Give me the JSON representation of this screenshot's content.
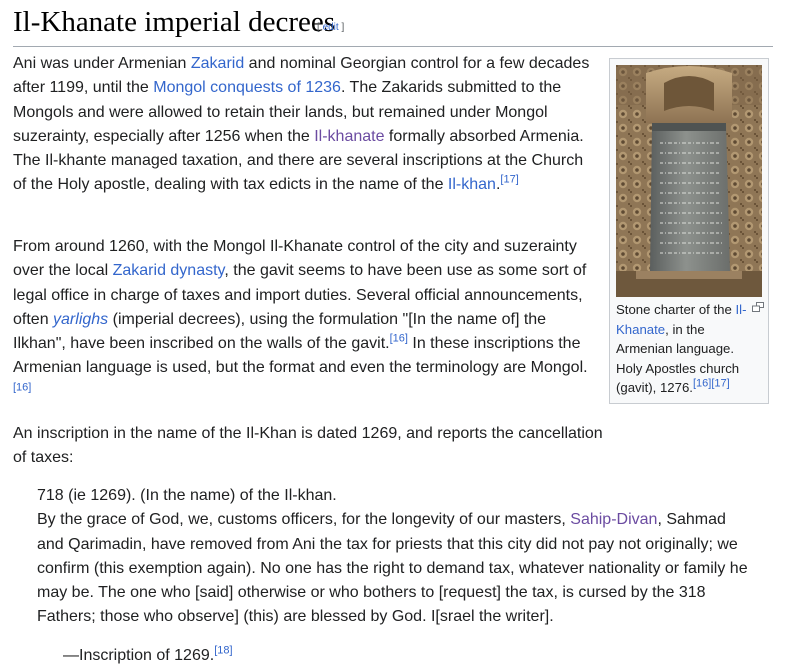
{
  "section": {
    "title": "Il-Khanate imperial decrees",
    "edit_open": "[ ",
    "edit_label": "edit",
    "edit_close": " ]"
  },
  "p1": {
    "t1": "Ani was under Armenian ",
    "l1": "Zakarid",
    "t2": " and nominal Georgian control for a few decades after 1199, until the ",
    "l2": "Mongol conquests of 1236",
    "t3": ". The Zakarids submitted to the Mongols and were allowed to retain their lands, but remained under Mongol suzerainty, especially after 1256 when the ",
    "l3": "Il-khanate",
    "t4": " formally absorbed Armenia. The Il-khante managed taxation, and there are several inscriptions at the Church of the Holy apostle, dealing with tax edicts in the name of the ",
    "l4": "Il-khan",
    "t5": ".",
    "ref1": "[17]"
  },
  "p2": {
    "t1": "From around 1260, with the Mongol Il-Khanate control of the city and suzerainty over the local ",
    "l1": "Zakarid dynasty",
    "t2": ", the gavit seems to have been use as some sort of legal office in charge of taxes and import duties. Several official announcements, often ",
    "l2": "yarlighs",
    "t3": " (imperial decrees), using the formulation \"[In the name of] the Ilkhan\", have been inscribed on the walls of the gavit.",
    "ref1": "[16]",
    "t4": " In these inscriptions the Armenian language is used, but the format and even the terminology are Mongol.",
    "ref2": "[16]"
  },
  "p3": {
    "text": "An inscription in the name of the Il-Khan is dated 1269, and reports the cancellation of taxes:"
  },
  "quote": {
    "line1": "718 (ie 1269). (In the name) of the Il-khan.",
    "t1": "By the grace of God, we, customs officers, for the longevity of our masters, ",
    "l1": "Sahip-Divan",
    "t2": ", Sahmad and Qarimadin, have removed from Ani the tax for priests that this city did not pay not originally; we confirm (this exemption again). No one has the right to demand tax, whatever nationality or family he may be. The one who [said] otherwise or who bothers to [request] the tax, is cursed by the 318 Fathers; those who observe] (this) are blessed by God. I[srael the writer]."
  },
  "attribution": {
    "dash": "—",
    "text": "Inscription of 1269.",
    "ref": "[18]"
  },
  "figure": {
    "caption_t1": "Stone charter of the ",
    "caption_link": "Il-Khanate",
    "caption_t2": ", in the Armenian language. Holy Apostles church (gavit), 1276.",
    "ref1": "[16]",
    "ref2": "[17]",
    "magnify_icon": "magnify-clip-icon"
  },
  "colors": {
    "link": "#3366cc",
    "visited_link": "#6b4ba1",
    "text": "#202122",
    "rule": "#a2a9b1"
  }
}
